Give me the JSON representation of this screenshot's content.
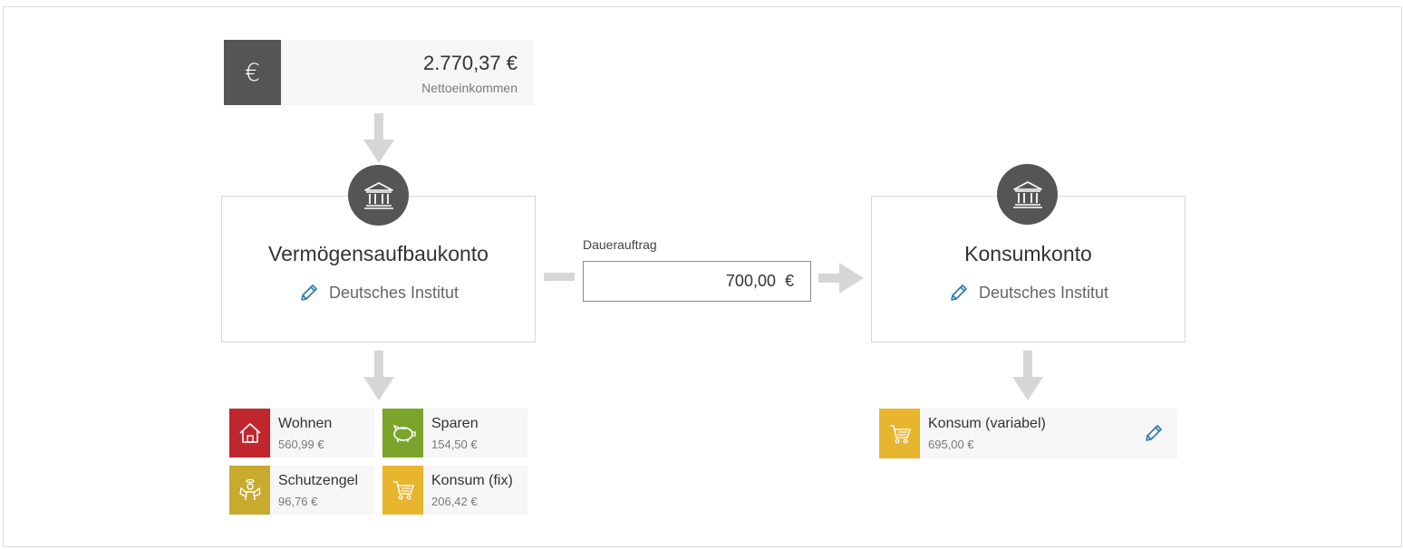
{
  "income": {
    "icon": "euro-icon",
    "symbol": "€",
    "amount": "2.770,37 €",
    "label": "Nettoeinkommen"
  },
  "accounts": {
    "left": {
      "icon": "bank-icon",
      "title": "Vermögensaufbaukonto",
      "institution": "Deutsches Institut"
    },
    "right": {
      "icon": "bank-icon",
      "title": "Konsumkonto",
      "institution": "Deutsches Institut"
    }
  },
  "standing_order": {
    "label": "Dauerauftrag",
    "amount": "700,00",
    "currency": "€"
  },
  "categories": [
    {
      "name": "Wohnen",
      "amount": "560,99 €",
      "color": "#c0272d",
      "icon": "house-icon"
    },
    {
      "name": "Sparen",
      "amount": "154,50 €",
      "color": "#7aa52a",
      "icon": "piggy-bank-icon"
    },
    {
      "name": "Schutzengel",
      "amount": "96,76 €",
      "color": "#c7aa2e",
      "icon": "guardian-angel-icon"
    },
    {
      "name": "Konsum (fix)",
      "amount": "206,42 €",
      "color": "#e8b52e",
      "icon": "cart-icon"
    }
  ],
  "consumption": {
    "name": "Konsum (variabel)",
    "amount": "695,00 €",
    "color": "#e8b52e",
    "icon": "cart-icon"
  },
  "colors": {
    "dark": "#555555",
    "arrow": "#d6d6d6",
    "edit": "#2a7ab0"
  }
}
